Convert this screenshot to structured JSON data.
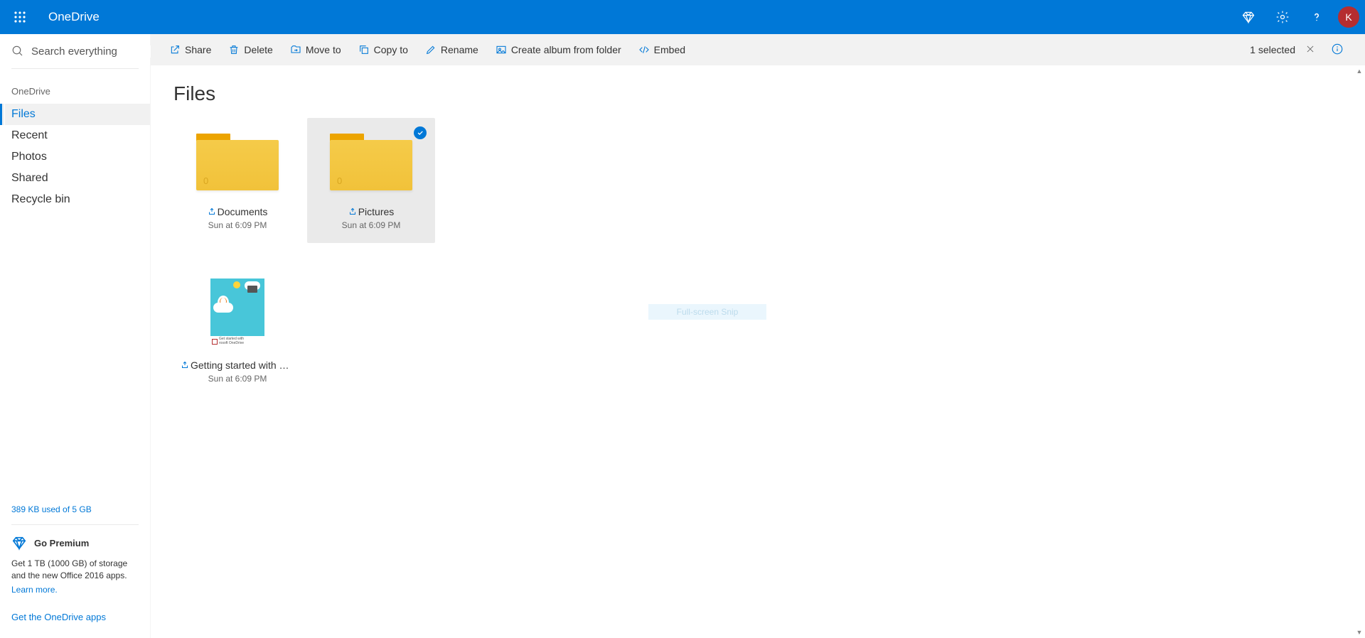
{
  "header": {
    "app_title": "OneDrive",
    "avatar_initial": "K"
  },
  "search": {
    "placeholder": "Search everything"
  },
  "sidebar": {
    "root_label": "OneDrive",
    "items": [
      "Files",
      "Recent",
      "Photos",
      "Shared",
      "Recycle bin"
    ],
    "active_index": 0,
    "storage_text": "389 KB used of 5 GB",
    "premium_title": "Go Premium",
    "premium_text": "Get 1 TB (1000 GB) of storage and the new Office 2016 apps.",
    "premium_link": "Learn more.",
    "get_apps_link": "Get the OneDrive apps"
  },
  "commandbar": {
    "actions": [
      "Share",
      "Delete",
      "Move to",
      "Copy to",
      "Rename",
      "Create album from folder",
      "Embed"
    ],
    "selected_text": "1 selected"
  },
  "content": {
    "page_title": "Files",
    "items": [
      {
        "type": "folder",
        "name": "Documents",
        "date": "Sun at 6:09 PM",
        "count": "0",
        "selected": false
      },
      {
        "type": "folder",
        "name": "Pictures",
        "date": "Sun at 6:09 PM",
        "count": "0",
        "selected": true
      },
      {
        "type": "file",
        "name": "Getting started with On...",
        "date": "Sun at 6:09 PM",
        "selected": false,
        "thumb_caption_1": "Get started with",
        "thumb_caption_2": "rosoft OneDrive"
      }
    ],
    "hint_overlay": "Full-screen Snip"
  }
}
